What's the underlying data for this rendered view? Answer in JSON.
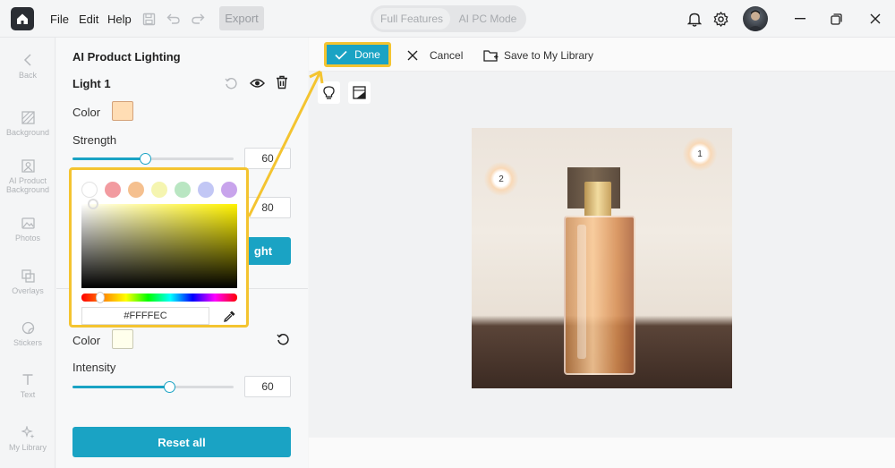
{
  "menu": {
    "file": "File",
    "edit": "Edit",
    "help": "Help",
    "export": "Export"
  },
  "modes": {
    "full": "Full Features",
    "ai_pc": "AI PC Mode"
  },
  "rail": [
    {
      "label": "Back",
      "icon": "chevron-left-icon"
    },
    {
      "label": "Background",
      "icon": "background-icon"
    },
    {
      "label": "AI Product Background",
      "icon": "ai-background-icon"
    },
    {
      "label": "Photos",
      "icon": "photo-icon"
    },
    {
      "label": "Overlays",
      "icon": "overlays-icon"
    },
    {
      "label": "Stickers",
      "icon": "sticker-icon"
    },
    {
      "label": "Text",
      "icon": "text-icon"
    },
    {
      "label": "My Library",
      "icon": "library-icon"
    }
  ],
  "panel": {
    "title": "AI Product Lighting",
    "light_name": "Light 1",
    "color_label": "Color",
    "light_color": "#FFDDB4",
    "strength_label": "Strength",
    "strength_value": "60",
    "strength_fraction": 0.45,
    "second_value": "80",
    "hidden_button_text": "ght",
    "ambient_color_label": "Color",
    "ambient_color": "#FFFFEC",
    "intensity_label": "Intensity",
    "intensity_value": "60",
    "intensity_fraction": 0.6,
    "reset_all": "Reset all"
  },
  "picker": {
    "hex": "#FFFFEC",
    "presets": [
      "#ffffff",
      "#f29ba0",
      "#f5c08f",
      "#f5f5b0",
      "#b9e6c2",
      "#c2c7f5",
      "#c8a4ec"
    ],
    "highlight_color": "#f4c430"
  },
  "actions": {
    "done": "Done",
    "cancel": "Cancel",
    "save": "Save to My Library"
  },
  "photo": {
    "marker1": "1",
    "marker2": "2"
  },
  "colors": {
    "accent": "#1aa3c4"
  }
}
